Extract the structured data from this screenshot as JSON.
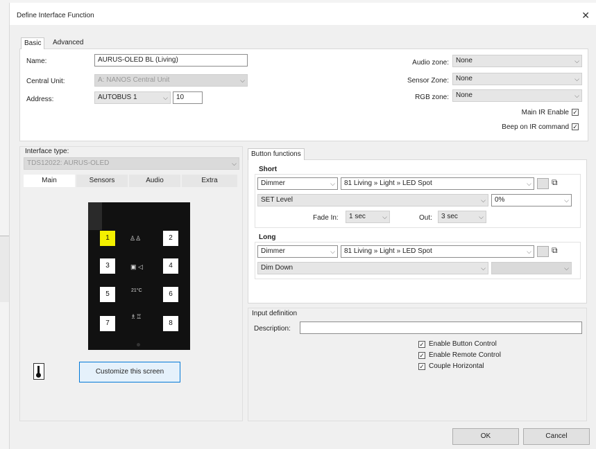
{
  "dialog": {
    "title": "Define Interface Function",
    "close_glyph": "✕"
  },
  "tabs": [
    {
      "label": "Basic"
    },
    {
      "label": "Advanced"
    }
  ],
  "basic": {
    "name_label": "Name:",
    "name_value": "AURUS-OLED BL (Living)",
    "central_unit_label": "Central Unit:",
    "central_unit_value": "A: NANOS Central Unit",
    "address_label": "Address:",
    "address_bus_value": "AUTOBUS 1",
    "address_number_value": "10",
    "audio_zone_label": "Audio zone:",
    "audio_zone_value": "None",
    "sensor_zone_label": "Sensor Zone:",
    "sensor_zone_value": "None",
    "rgb_zone_label": "RGB zone:",
    "rgb_zone_value": "None",
    "main_ir_label": "Main IR Enable",
    "main_ir_checked": true,
    "beep_ir_label": "Beep on IR command",
    "beep_ir_checked": true
  },
  "interface": {
    "type_label": "Interface type:",
    "type_value": "TDS12022: AURUS-OLED",
    "subtabs": [
      {
        "label": "Main"
      },
      {
        "label": "Sensors"
      },
      {
        "label": "Audio"
      },
      {
        "label": "Extra"
      }
    ],
    "keys": [
      "1",
      "2",
      "3",
      "4",
      "5",
      "6",
      "7",
      "8"
    ],
    "center_text": "21°C",
    "customize_label": "Customize this screen",
    "thermo_icon": "thermometer-icon"
  },
  "button_functions": {
    "tab_label": "Button functions",
    "short": {
      "heading": "Short",
      "function_value": "Dimmer",
      "target_value": "81  Living » Light » LED Spot",
      "action_value": "SET Level",
      "level_value": "0%",
      "fade_in_label": "Fade In:",
      "fade_in_value": "1 sec",
      "out_label": "Out:",
      "out_value": "3 sec"
    },
    "long": {
      "heading": "Long",
      "function_value": "Dimmer",
      "target_value": "81  Living » Light » LED Spot",
      "action_value": "Dim Down"
    }
  },
  "input_definition": {
    "heading": "Input definition",
    "description_label": "Description:",
    "description_value": "",
    "enable_button_control_label": "Enable Button Control",
    "enable_remote_control_label": "Enable Remote Control",
    "couple_horizontal_label": "Couple Horizontal"
  },
  "footer": {
    "ok_label": "OK",
    "cancel_label": "Cancel"
  }
}
